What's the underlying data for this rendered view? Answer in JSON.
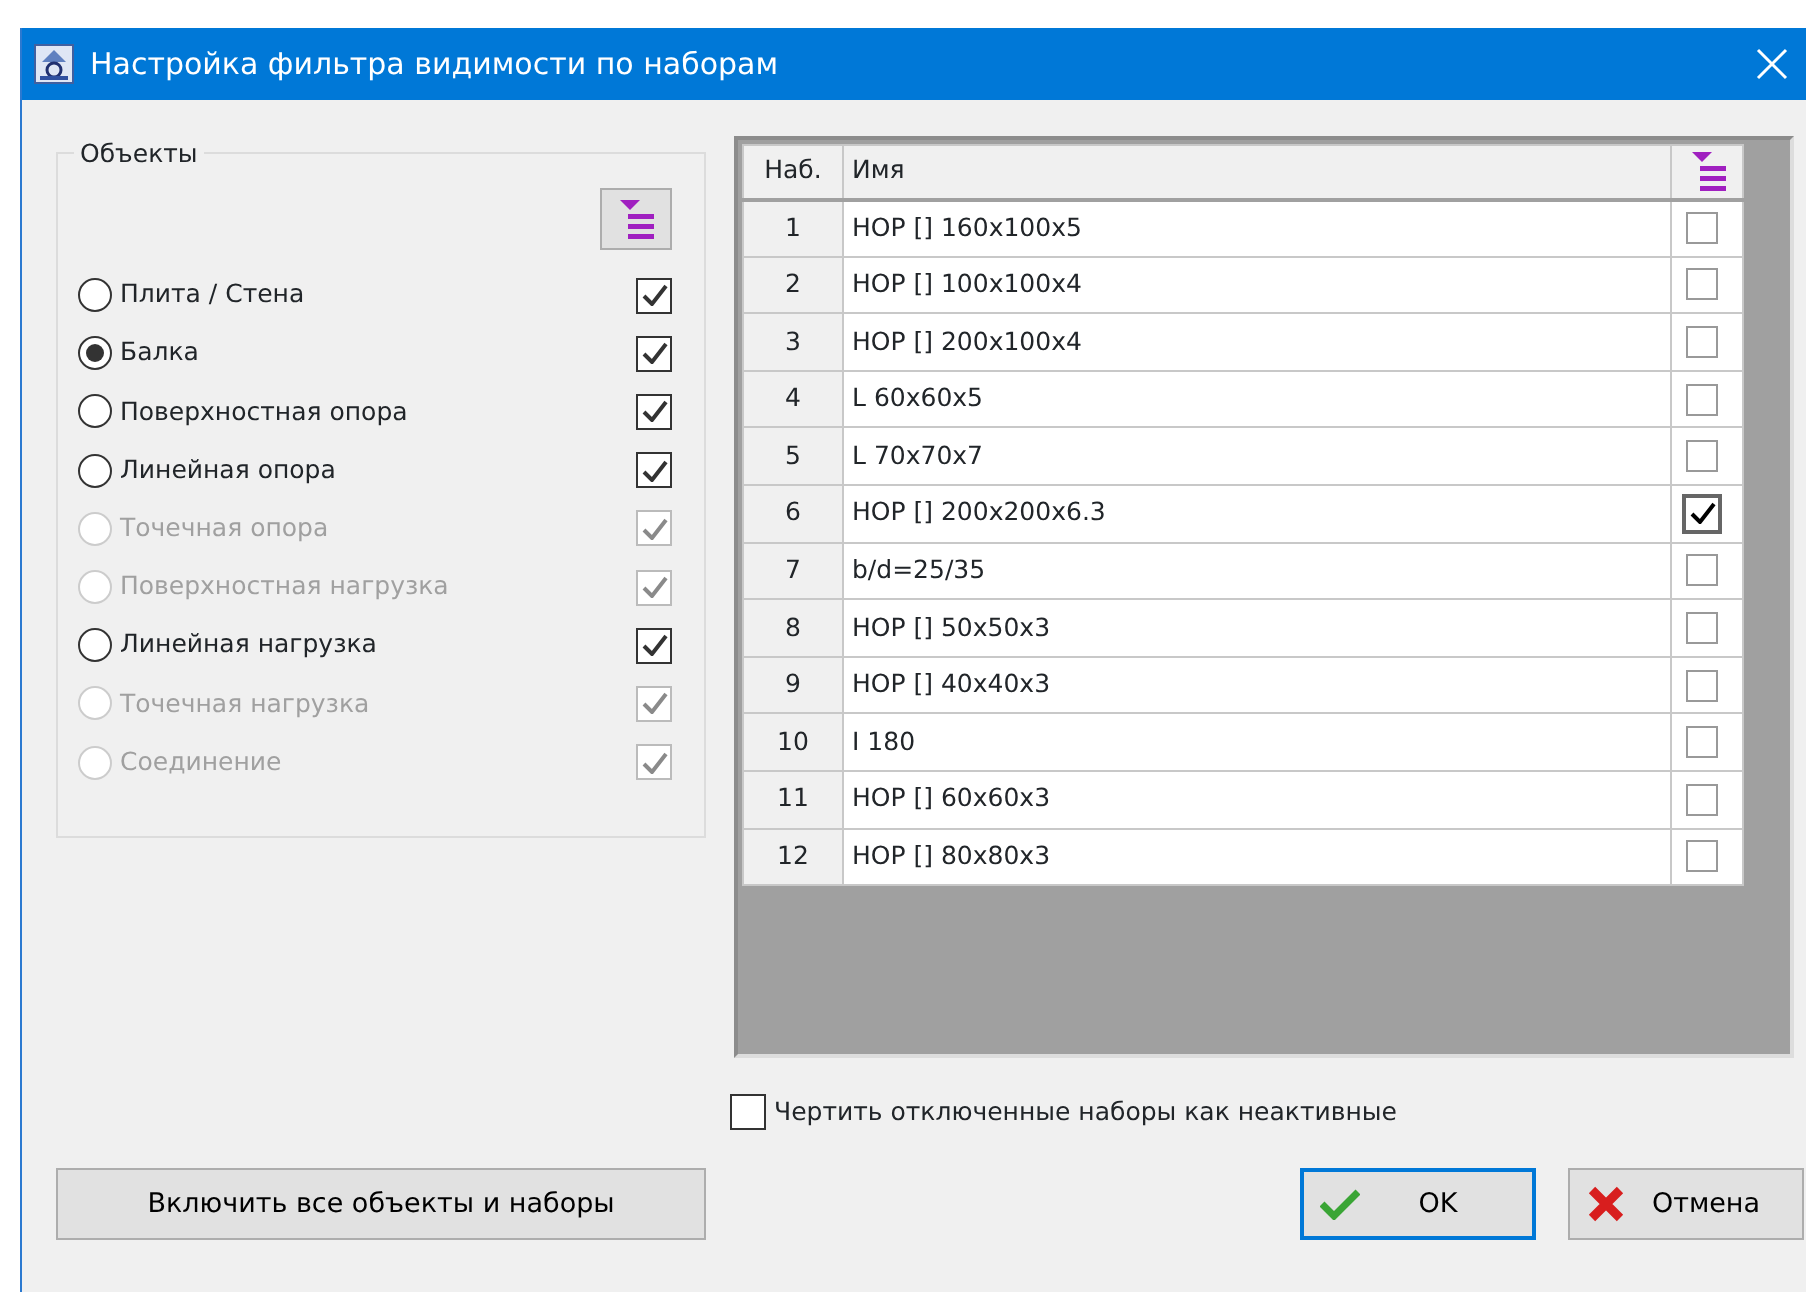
{
  "window": {
    "title": "Настройка фильтра видимости по наборам"
  },
  "objects": {
    "title": "Объекты",
    "items": [
      {
        "label": "Плита / Стена",
        "selected": false,
        "disabled": false,
        "checked": true
      },
      {
        "label": "Балка",
        "selected": true,
        "disabled": false,
        "checked": true
      },
      {
        "label": "Поверхностная опора",
        "selected": false,
        "disabled": false,
        "checked": true
      },
      {
        "label": "Линейная опора",
        "selected": false,
        "disabled": false,
        "checked": true
      },
      {
        "label": "Точечная опора",
        "selected": false,
        "disabled": true,
        "checked": true
      },
      {
        "label": "Поверхностная нагрузка",
        "selected": false,
        "disabled": true,
        "checked": true
      },
      {
        "label": "Линейная нагрузка",
        "selected": false,
        "disabled": false,
        "checked": true
      },
      {
        "label": "Точечная нагрузка",
        "selected": false,
        "disabled": true,
        "checked": true
      },
      {
        "label": "Соединение",
        "selected": false,
        "disabled": true,
        "checked": true
      }
    ]
  },
  "sets": {
    "columns": [
      "Наб.",
      "Имя"
    ],
    "rows": [
      {
        "number": "1",
        "name": "НОР [] 160x100x5",
        "checked": false,
        "focused": false
      },
      {
        "number": "2",
        "name": "НОР [] 100x100x4",
        "checked": false,
        "focused": false
      },
      {
        "number": "3",
        "name": "НОР [] 200x100x4",
        "checked": false,
        "focused": false
      },
      {
        "number": "4",
        "name": "L 60x60x5",
        "checked": false,
        "focused": false
      },
      {
        "number": "5",
        "name": "L 70x70x7",
        "checked": false,
        "focused": false
      },
      {
        "number": "6",
        "name": "НОР [] 200x200x6.3",
        "checked": true,
        "focused": true
      },
      {
        "number": "7",
        "name": "b/d=25/35",
        "checked": false,
        "focused": false
      },
      {
        "number": "8",
        "name": "НОР [] 50x50x3",
        "checked": false,
        "focused": false
      },
      {
        "number": "9",
        "name": "НОР [] 40x40x3",
        "checked": false,
        "focused": false
      },
      {
        "number": "10",
        "name": "I 180",
        "checked": false,
        "focused": false
      },
      {
        "number": "11",
        "name": "НОР [] 60x60x3",
        "checked": false,
        "focused": false
      },
      {
        "number": "12",
        "name": "НОР [] 80x80x3",
        "checked": false,
        "focused": false
      }
    ]
  },
  "draw_inactive": {
    "label": "Чертить отключенные наборы как неактивные",
    "checked": false
  },
  "buttons": {
    "enable_all": "Включить все объекты и наборы",
    "ok": "OK",
    "cancel": "Отмена"
  }
}
